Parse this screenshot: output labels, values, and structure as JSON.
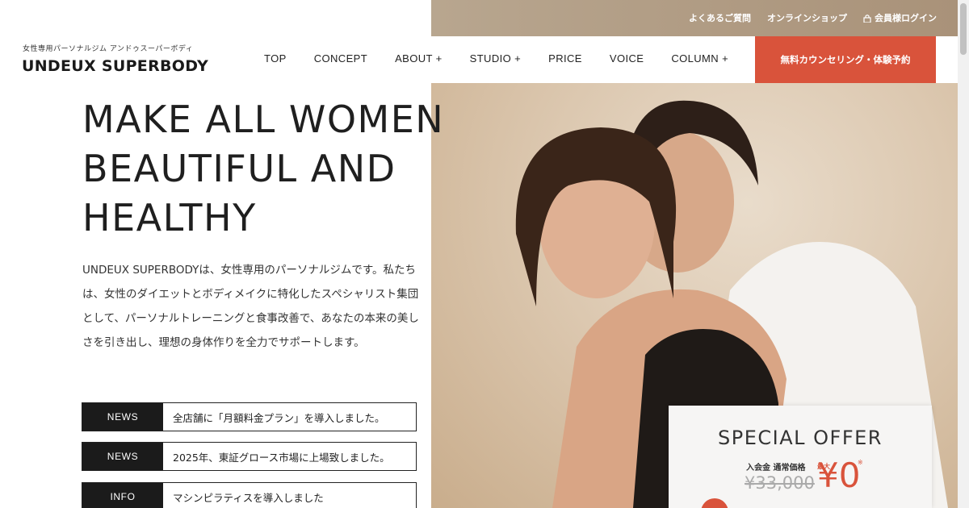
{
  "utility_nav": [
    {
      "label": "よくあるご質問"
    },
    {
      "label": "オンラインショップ"
    },
    {
      "label": "会員様ログイン",
      "icon": "lock-icon"
    }
  ],
  "brand": {
    "subtitle": "女性専用パーソナルジム アンドゥスーパーボディ",
    "logo": "UNDEUX SUPERBODY"
  },
  "nav": {
    "items": [
      "TOP",
      "CONCEPT",
      "ABOUT +",
      "STUDIO +",
      "PRICE",
      "VOICE",
      "COLUMN +"
    ],
    "cta": "無料カウンセリング・体験予約"
  },
  "hero": {
    "headline": [
      "MAKE ALL WOMEN",
      "BEAUTIFUL AND",
      "HEALTHY"
    ],
    "intro": "UNDEUX SUPERBODYは、女性専用のパーソナルジムです。私たちは、女性のダイエットとボディメイクに特化したスペシャリスト集団として、パーソナルトレーニングと食事改善で、あなたの本来の美しさを引き出し、理想の身体作りを全力でサポートします。"
  },
  "news": [
    {
      "tag": "NEWS",
      "text": "全店舗に「月額料金プラン」を導入しました。"
    },
    {
      "tag": "NEWS",
      "text": "2025年、東証グロース市場に上場致しました。"
    },
    {
      "tag": "INFO",
      "text": "マシンピラティスを導入しました"
    }
  ],
  "offer": {
    "title": "SPECIAL OFFER",
    "label": "入会金 通常価格",
    "old_price": "¥33,000",
    "max_label": "最大",
    "new_price": "¥0",
    "note": "※"
  },
  "colors": {
    "accent": "#d9533b",
    "dark": "#1b1b1b"
  }
}
